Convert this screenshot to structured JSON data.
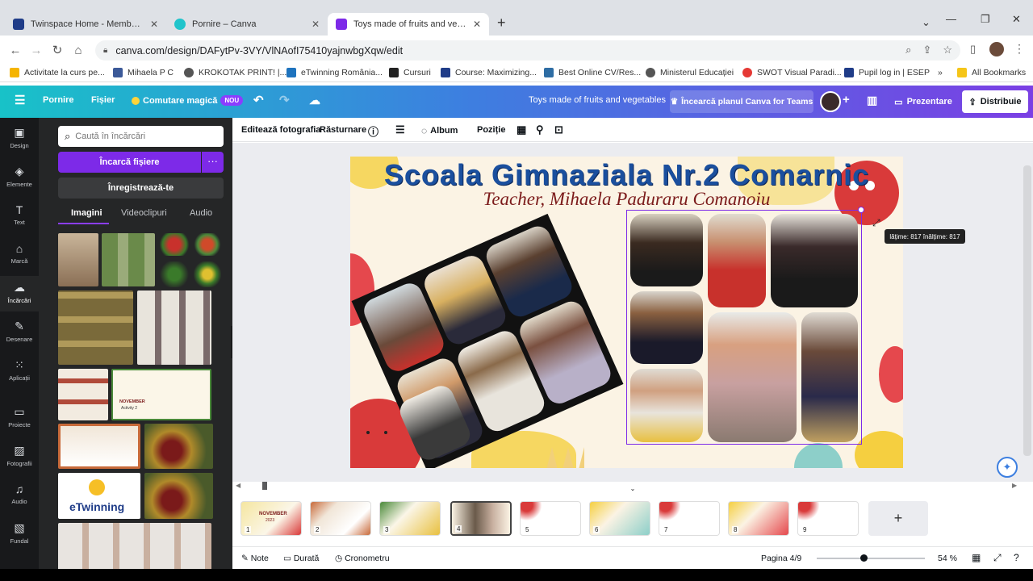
{
  "browser": {
    "tabs": [
      {
        "title": "Twinspace Home - Member | ESE",
        "color": "#1f3c88"
      },
      {
        "title": "Pornire – Canva",
        "color": "#20c4cb"
      },
      {
        "title": "Toys made of fruits and vegetab",
        "color": "#7d2ae8"
      }
    ],
    "new_tab": "+",
    "url": "canva.com/design/DAFytPv-3VY/VlNAofI75410yajnwbgXqw/edit",
    "bookmarks": [
      {
        "label": "Activitate la curs pe...",
        "color": "#f5b400"
      },
      {
        "label": "Mihaela P C",
        "color": "#3b5998"
      },
      {
        "label": "KROKOTAK PRINT! |...",
        "color": "#555555"
      },
      {
        "label": "eTwinning România...",
        "color": "#1e73be"
      },
      {
        "label": "Cursuri",
        "color": "#222222"
      },
      {
        "label": "Course: Maximizing...",
        "color": "#1f3c88"
      },
      {
        "label": "Best Online CV/Res...",
        "color": "#2e6da4"
      },
      {
        "label": "Ministerul Educației",
        "color": "#555555"
      },
      {
        "label": "SWOT Visual Paradi...",
        "color": "#e53935"
      },
      {
        "label": "Pupil log in | ESEP",
        "color": "#1f3c88"
      },
      {
        "label": "All Bookmarks",
        "color": "#f5c518"
      }
    ],
    "more_bookmarks": "»"
  },
  "canva_header": {
    "menu_icon": "☰",
    "home": "Pornire",
    "file": "Fișier",
    "magic": "Comutare magică",
    "badge": "NOU",
    "doc_title": "Toys made of fruits and vegetables",
    "upgrade": "Încearcă planul Canva for Teams",
    "present": "Prezentare",
    "share": "Distribuie",
    "plus": "+"
  },
  "rail": [
    {
      "label": "Design",
      "icon": "▣"
    },
    {
      "label": "Elemente",
      "icon": "◈"
    },
    {
      "label": "Text",
      "icon": "T"
    },
    {
      "label": "Marcă",
      "icon": "⌂"
    },
    {
      "label": "Încărcări",
      "icon": "☁"
    },
    {
      "label": "Desenare",
      "icon": "✎"
    },
    {
      "label": "Aplicații",
      "icon": "⁙"
    },
    {
      "label": "Proiecte",
      "icon": "▭"
    },
    {
      "label": "Fotografii",
      "icon": "▨"
    },
    {
      "label": "Audio",
      "icon": "♫"
    },
    {
      "label": "Fundal",
      "icon": "▧"
    }
  ],
  "panel": {
    "search_placeholder": "Caută în încărcări",
    "upload": "Încarcă fișiere",
    "more": "···",
    "record": "Înregistrează-te",
    "tabs": [
      "Imagini",
      "Videoclipuri",
      "Audio"
    ],
    "etwinning_label": "eTwinning",
    "card_label_1": "NOVEMBER",
    "card_label_2": "Activity 2"
  },
  "toolbar": {
    "edit_photo": "Editează fotografia",
    "flip": "Răsturnare",
    "album": "Album",
    "position": "Poziție"
  },
  "slide": {
    "title": "Scoala Gimnaziala Nr.2 Comarnic",
    "subtitle": "Teacher, Mihaela Paduraru Comanoiu",
    "tooltip": "lățime: 817 înălțime: 817"
  },
  "pages": {
    "numbers": [
      "1",
      "2",
      "3",
      "4",
      "5",
      "6",
      "7",
      "8",
      "9"
    ],
    "current": "4",
    "add": "+",
    "thumb1_label": "NOVEMBER",
    "thumb1_year": "2023"
  },
  "footer": {
    "notes": "Note",
    "duration": "Durată",
    "timer": "Cronometru",
    "page_indicator": "Pagina 4/9",
    "zoom": "54 %"
  }
}
